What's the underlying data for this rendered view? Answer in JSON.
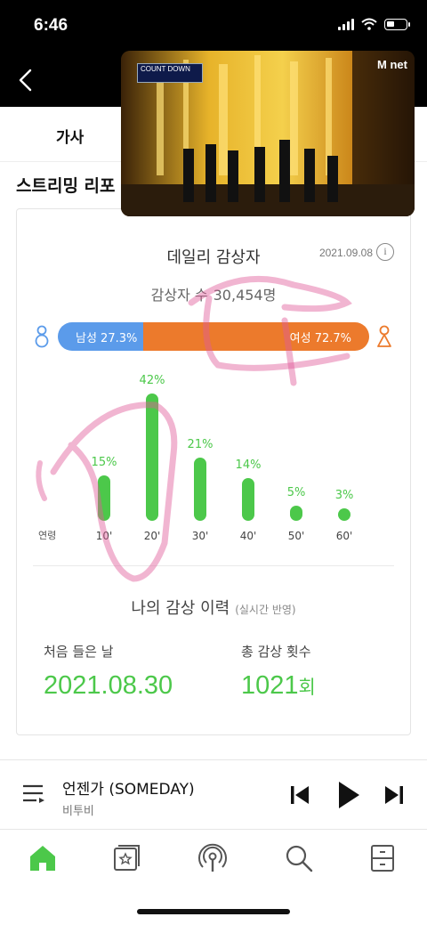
{
  "status": {
    "time": "6:46"
  },
  "tabs": {
    "lyrics": "가사"
  },
  "section": {
    "title": "스트리밍 리포"
  },
  "pip": {
    "show_logo": "COUNT DOWN",
    "channel_logo": "M net"
  },
  "daily": {
    "title": "데일리 감상자",
    "date": "2021.09.08",
    "info_icon": "i",
    "listeners_label": "감상자 수",
    "listeners_value": "30,454명",
    "male_label": "남성 27.3%",
    "female_label": "여성 72.7%",
    "male_share": 27.3,
    "female_share": 72.7,
    "colors": {
      "male": "#5b9bea",
      "female": "#ec7a2c",
      "accent": "#4cc84a"
    }
  },
  "age_chart": {
    "axis_label": "연령",
    "groups": [
      {
        "age": "10'",
        "pct_label": "15%",
        "value": 15
      },
      {
        "age": "20'",
        "pct_label": "42%",
        "value": 42
      },
      {
        "age": "30'",
        "pct_label": "21%",
        "value": 21
      },
      {
        "age": "40'",
        "pct_label": "14%",
        "value": 14
      },
      {
        "age": "50'",
        "pct_label": "5%",
        "value": 5
      },
      {
        "age": "60'",
        "pct_label": "3%",
        "value": 3
      }
    ]
  },
  "chart_data": {
    "type": "bar",
    "categories": [
      "10'",
      "20'",
      "30'",
      "40'",
      "50'",
      "60'"
    ],
    "values": [
      15,
      42,
      21,
      14,
      5,
      3
    ],
    "xlabel": "연령"
  },
  "history": {
    "title": "나의 감상 이력",
    "note": "(실시간 반영)",
    "first_label": "처음 들은 날",
    "first_value": "2021.08.30",
    "total_label": "총 감상 횟수",
    "total_value": "1021",
    "total_unit": "회"
  },
  "player": {
    "title": "언젠가 (SOMEDAY)",
    "artist": "비투비"
  },
  "nav": {
    "items": [
      "home-icon",
      "playlist-star-icon",
      "podcast-icon",
      "search-icon",
      "library-icon"
    ],
    "active_color": "#4cc84a"
  }
}
